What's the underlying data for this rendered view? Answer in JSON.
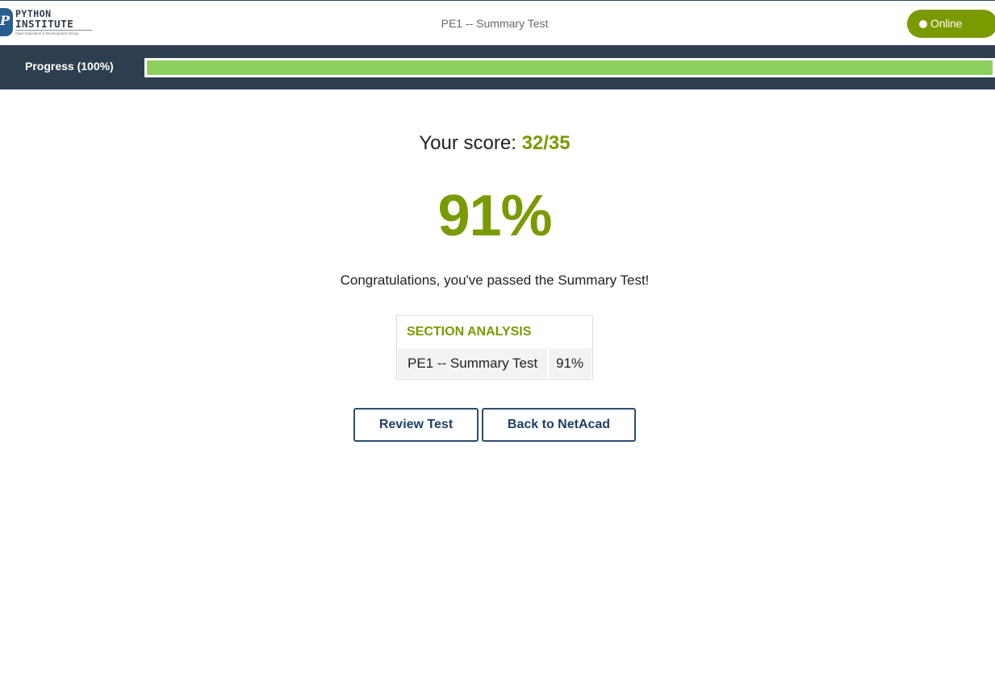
{
  "header": {
    "logo": {
      "line1": "PYTHON",
      "line2": "INSTITUTE",
      "tagline": "Open Education & Development Group"
    },
    "title": "PE1 -- Summary Test",
    "status": {
      "label": "Online",
      "color": "#7a9a01"
    }
  },
  "progress": {
    "label": "Progress (100%)",
    "percent": 100,
    "bar_color": "#8ccf5e"
  },
  "result": {
    "score_label": "Your score:",
    "score_value": "32/35",
    "percent": "91%",
    "message": "Congratulations, you've passed the Summary Test!",
    "accent_color": "#7a9a01"
  },
  "section_analysis": {
    "title": "SECTION ANALYSIS",
    "rows": [
      {
        "name": "PE1 -- Summary Test",
        "score": "91%"
      }
    ]
  },
  "actions": {
    "review_label": "Review Test",
    "back_label": "Back to NetAcad"
  }
}
